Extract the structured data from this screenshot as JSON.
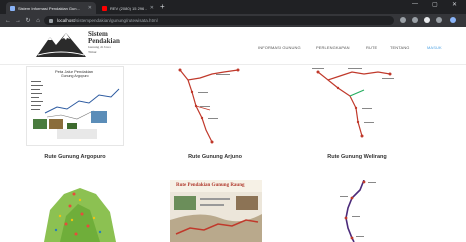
{
  "browser": {
    "tabs": [
      {
        "title": "Sistem Informasi Pendakian Gun...",
        "favicon_color": "#8ab4f8",
        "active": true
      },
      {
        "title": "REV (2080) 15 296 - 2080",
        "favicon_color": "#ff0000",
        "active": false
      }
    ],
    "new_tab": "+",
    "url_host": "localhost",
    "url_path": "/sistempendakian/gunung/rutewisata.html",
    "controls": {
      "minimize": "—",
      "maximize": "▢",
      "close": "✕"
    }
  },
  "site": {
    "brand": {
      "line1": "Sistem",
      "line2": "Pendakian",
      "line3a": "Gunung di Jawa",
      "line3b": "Timur"
    },
    "menu": [
      {
        "label": "INFORMASI GUNUNG",
        "active": false
      },
      {
        "label": "PERLENGKAPAN",
        "active": false
      },
      {
        "label": "RUTE",
        "active": false
      },
      {
        "label": "TENTANG",
        "active": false
      },
      {
        "label": "MASUK",
        "active": true
      }
    ]
  },
  "routes": [
    {
      "caption": "Rute Gunung Argopuro",
      "map_title": "Peta Jalur Pendakian",
      "map_subtitle": "Gunung Argopuro"
    },
    {
      "caption": "Rute Gunung Arjuno"
    },
    {
      "caption": "Rute Gunung Welirang"
    },
    {
      "caption": ""
    },
    {
      "caption": "",
      "map_title": "Rute Pendakian Gunung Raung"
    },
    {
      "caption": ""
    }
  ],
  "colors": {
    "accent": "#4fa3e3",
    "route_red": "#c0392b",
    "route_purple": "#4b2a7a",
    "chrome_dark": "#202124"
  }
}
